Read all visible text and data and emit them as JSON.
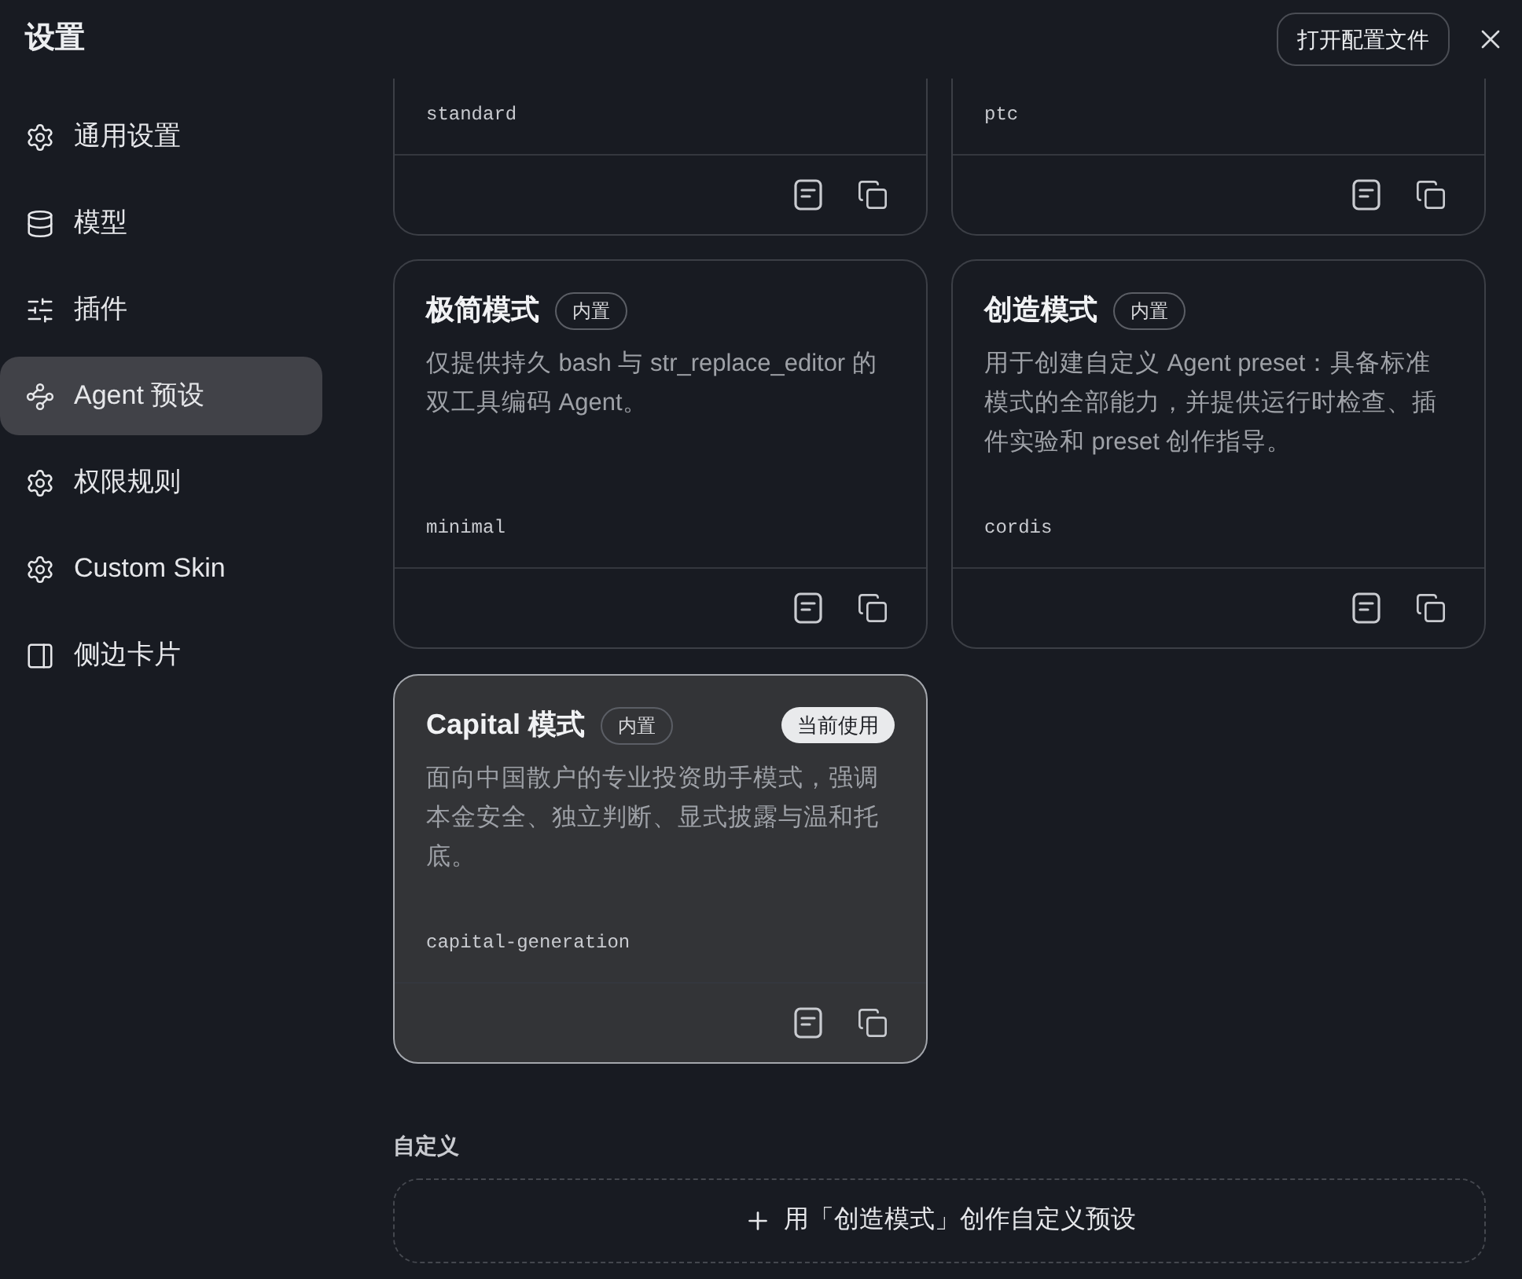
{
  "window": {
    "title": "设置",
    "open_config_button": "打开配置文件"
  },
  "sidebar": {
    "items": [
      {
        "label": "通用设置",
        "kind": "general",
        "selected": false
      },
      {
        "label": "模型",
        "kind": "model",
        "selected": false
      },
      {
        "label": "插件",
        "kind": "plugin",
        "selected": false
      },
      {
        "label": "Agent 预设",
        "kind": "agent",
        "selected": true
      },
      {
        "label": "权限规则",
        "kind": "general",
        "selected": false
      },
      {
        "label": "Custom Skin",
        "kind": "general",
        "selected": false
      },
      {
        "label": "侧边卡片",
        "kind": "panel",
        "selected": false
      }
    ]
  },
  "presets_partial": [
    {
      "code": "standard"
    },
    {
      "code": "ptc"
    }
  ],
  "presets": [
    {
      "title": "极简模式",
      "badge": "内置",
      "description": "仅提供持久 bash 与 str_replace_editor 的双工具编码 Agent。",
      "code": "minimal",
      "selected": false
    },
    {
      "title": "创造模式",
      "badge": "内置",
      "description": "用于创建自定义 Agent preset：具备标准模式的全部能力，并提供运行时检查、插件实验和 preset 创作指导。",
      "code": "cordis",
      "selected": false
    },
    {
      "title": "Capital 模式",
      "badge": "内置",
      "status": "当前使用",
      "description": "面向中国散户的专业投资助手模式，强调本金安全、独立判断、显式披露与温和托底。",
      "code": "capital-generation",
      "selected": true
    }
  ],
  "custom_section": {
    "label": "自定义",
    "add_button": "用「创造模式」创作自定义预设"
  }
}
